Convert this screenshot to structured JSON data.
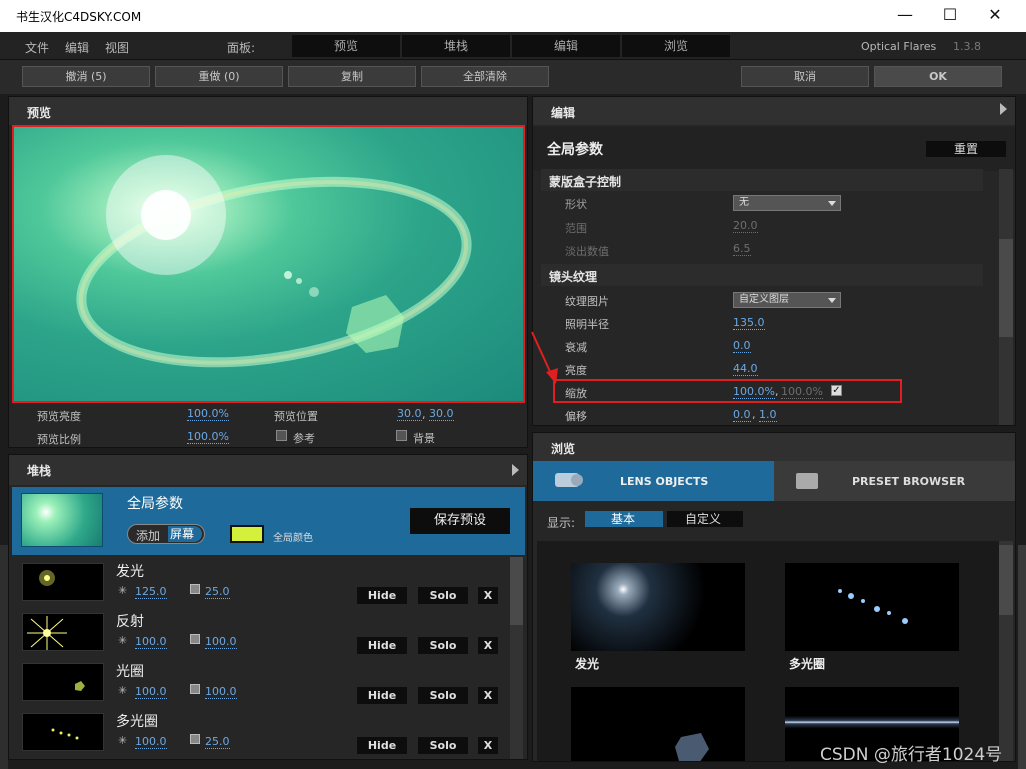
{
  "window": {
    "title": "书生汉化C4DSKY.COM",
    "minimize": "—",
    "maximize": "☐",
    "close": "✕"
  },
  "menu": {
    "file": "文件",
    "edit": "编辑",
    "view": "视图",
    "panel_label": "面板:",
    "panel_tabs": [
      "预览",
      "堆栈",
      "编辑",
      "浏览"
    ],
    "app_name": "Optical Flares",
    "version": "1.3.8"
  },
  "toolbar": {
    "undo": "撤消 (5)",
    "redo": "重做 (0)",
    "copy": "复制",
    "clear_all": "全部清除",
    "cancel": "取消",
    "ok": "OK"
  },
  "preview": {
    "title": "预览",
    "brightness_label": "预览亮度",
    "brightness_value": "100.0%",
    "position_label": "预览位置",
    "position_x": "30.0",
    "position_sep": ",",
    "position_y": "30.0",
    "scale_label": "预览比例",
    "scale_value": "100.0%",
    "ref_label": "参考",
    "bg_label": "背景"
  },
  "stack": {
    "title": "堆栈",
    "global": {
      "name": "全局参数",
      "add_label": "添加",
      "screen_label": "屏幕",
      "color_label": "全局颜色",
      "save_preset": "保存预设",
      "color": "#d4f03a"
    },
    "layers": [
      {
        "name": "发光",
        "v1": "125.0",
        "v2": "25.0",
        "hide": "Hide",
        "solo": "Solo",
        "x": "X"
      },
      {
        "name": "反射",
        "v1": "100.0",
        "v2": "100.0",
        "hide": "Hide",
        "solo": "Solo",
        "x": "X"
      },
      {
        "name": "光圈",
        "v1": "100.0",
        "v2": "100.0",
        "hide": "Hide",
        "solo": "Solo",
        "x": "X"
      },
      {
        "name": "多光圈",
        "v1": "100.0",
        "v2": "25.0",
        "hide": "Hide",
        "solo": "Solo",
        "x": "X"
      }
    ]
  },
  "editor": {
    "title": "编辑",
    "global_title": "全局参数",
    "reset": "重置",
    "mask_section": "蒙版盒子控制",
    "shape_label": "形状",
    "shape_value": "无",
    "range_label": "范围",
    "range_value": "20.0",
    "fade_label": "淡出数值",
    "fade_value": "6.5",
    "texture_section": "镜头纹理",
    "tex_image_label": "纹理图片",
    "tex_image_value": "自定义图层",
    "radius_label": "照明半径",
    "radius_value": "135.0",
    "falloff_label": "衰减",
    "falloff_value": "0.0",
    "brightness_label": "亮度",
    "brightness_value": "44.0",
    "scale_label": "缩放",
    "scale_x": "100.0%",
    "scale_sep": ",",
    "scale_y": "100.0%",
    "offset_label": "偏移",
    "offset_x": "0.0",
    "offset_sep": ",",
    "offset_y": "1.0"
  },
  "browser": {
    "title": "浏览",
    "tab_lens": "LENS OBJECTS",
    "tab_preset": "PRESET BROWSER",
    "show_label": "显示:",
    "filter_basic": "基本",
    "filter_custom": "自定义",
    "items": [
      "发光",
      "多光圈",
      "",
      ""
    ]
  },
  "watermark": "CSDN @旅行者1024号",
  "colors": {
    "accent": "#1a6b9e",
    "highlight": "#e02020",
    "link": "#6aa9e6"
  }
}
